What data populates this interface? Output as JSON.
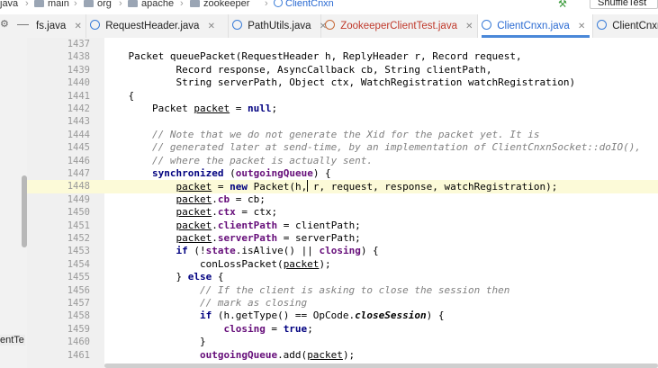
{
  "breadcrumb": {
    "items": [
      "java",
      "main",
      "org",
      "apache",
      "zookeeper",
      "ClientCnxn"
    ],
    "run_config": "ShuffleTest"
  },
  "tabs": [
    {
      "label": "fs.java",
      "state": "normal"
    },
    {
      "label": "RequestHeader.java",
      "state": "normal"
    },
    {
      "label": "PathUtils.java",
      "state": "normal"
    },
    {
      "label": "ZookeeperClientTest.java",
      "state": "error"
    },
    {
      "label": "ClientCnxn.java",
      "state": "active"
    },
    {
      "label": "ClientCnxn",
      "state": "normal"
    }
  ],
  "side_panel_label": "entTe",
  "gutter": {
    "line_numbers": [
      "1437",
      "1438",
      "1439",
      "1440",
      "1441",
      "1442",
      "1443",
      "1444",
      "1445",
      "1446",
      "1447",
      "1448",
      "1449",
      "1450",
      "1451",
      "1452",
      "1453",
      "1454",
      "1455",
      "1456",
      "1457",
      "1458",
      "1459",
      "1460",
      "1461"
    ],
    "highlighted_line": "1448"
  },
  "colors": {
    "keyword": "#000080",
    "field": "#660e7a",
    "comment": "#808080",
    "current_line": "#fcfad8",
    "active_tab_accent": "#4a88d8"
  }
}
